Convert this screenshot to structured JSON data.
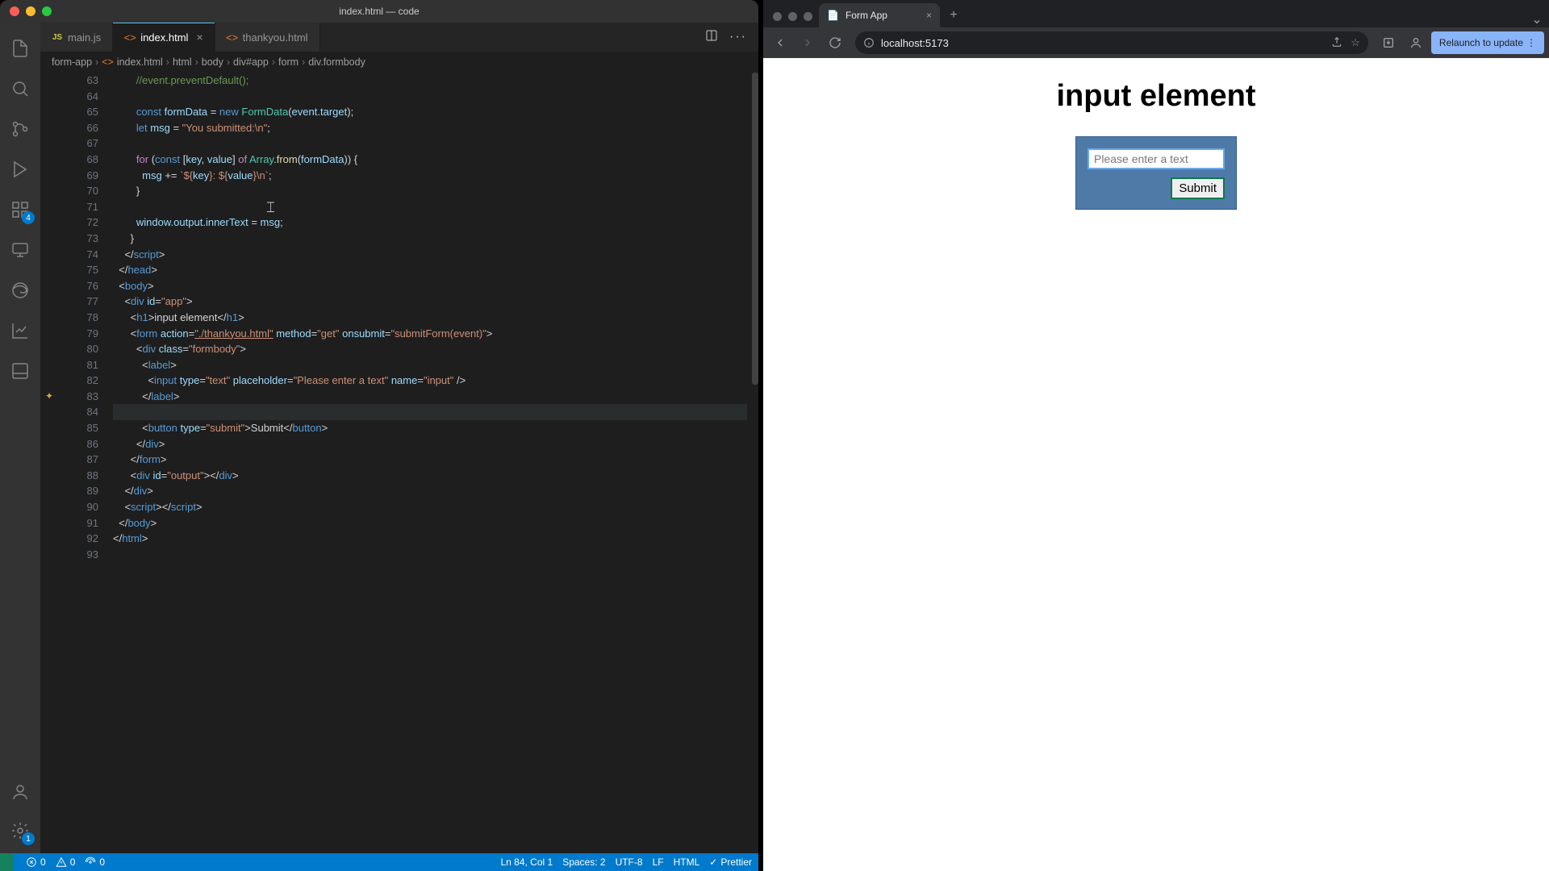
{
  "vscode": {
    "window_title": "index.html — code",
    "tabs": [
      {
        "label": "main.js",
        "icon_text": "JS"
      },
      {
        "label": "index.html",
        "icon_text": "<>"
      },
      {
        "label": "thankyou.html",
        "icon_text": "<>"
      }
    ],
    "breadcrumb": [
      "form-app",
      "index.html",
      "html",
      "body",
      "div#app",
      "form",
      "div.formbody"
    ],
    "activity_badges": {
      "scm": "4",
      "settings": "1"
    },
    "line_numbers": [
      "63",
      "64",
      "65",
      "66",
      "67",
      "68",
      "69",
      "70",
      "71",
      "72",
      "73",
      "74",
      "75",
      "76",
      "77",
      "78",
      "79",
      "80",
      "81",
      "82",
      "83",
      "84",
      "85",
      "86",
      "87",
      "88",
      "89",
      "90",
      "91",
      "92",
      "93"
    ],
    "code_text": {
      "forKw": "for",
      "ofKw": "of",
      "constKw": "const",
      "letKw": "let",
      "newKw": "new",
      "formDataV": "formData",
      "FormDataC": "FormData",
      "eventV": "event",
      "targetV": "target",
      "msgV": "msg",
      "youSubmitted": "\"You submitted:\\n\"",
      "keyV": "key",
      "valueV": "value",
      "ArrayC": "Array",
      "fromFn": "from",
      "tmplOpen": "`${",
      "tmplMid": "}: ${",
      "tmplClose": "}\\n`",
      "windowV": "window",
      "outputV": "output",
      "innerTextV": "innerText",
      "commentPrev": "//event.preventDefault();",
      "headClose": "head",
      "bodyOpen": "body",
      "scriptTag": "script",
      "htmlTag": "html",
      "divTag": "div",
      "h1Tag": "h1",
      "formTag": "form",
      "labelTag": "label",
      "inputTag": "input",
      "buttonTag": "button",
      "idAttr": "id",
      "appVal": "\"app\"",
      "classAttr": "class",
      "formbodyVal": "\"formbody\"",
      "h1Text": "input element",
      "actionAttr": "action",
      "actionVal": "\"./thankyou.html\"",
      "methodAttr": "method",
      "methodVal": "\"get\"",
      "onsubmitAttr": "onsubmit",
      "onsubmitVal": "\"submitForm(event)\"",
      "typeAttr": "type",
      "textVal": "\"text\"",
      "placeholderAttr": "placeholder",
      "placeholderVal": "\"Please enter a text\"",
      "nameAttr": "name",
      "nameVal": "\"input\"",
      "submitVal": "\"submit\"",
      "submitText": "Submit",
      "outputVal": "\"output\""
    },
    "statusbar": {
      "errors": "0",
      "warnings": "0",
      "ports": "0",
      "ln_col": "Ln 84, Col 1",
      "spaces": "Spaces: 2",
      "encoding": "UTF-8",
      "eol": "LF",
      "language": "HTML",
      "formatter": "Prettier"
    }
  },
  "browser": {
    "tab_title": "Form App",
    "url": "localhost:5173",
    "relaunch": "Relaunch to update",
    "page": {
      "heading": "input element",
      "placeholder": "Please enter a text",
      "submit": "Submit"
    }
  }
}
